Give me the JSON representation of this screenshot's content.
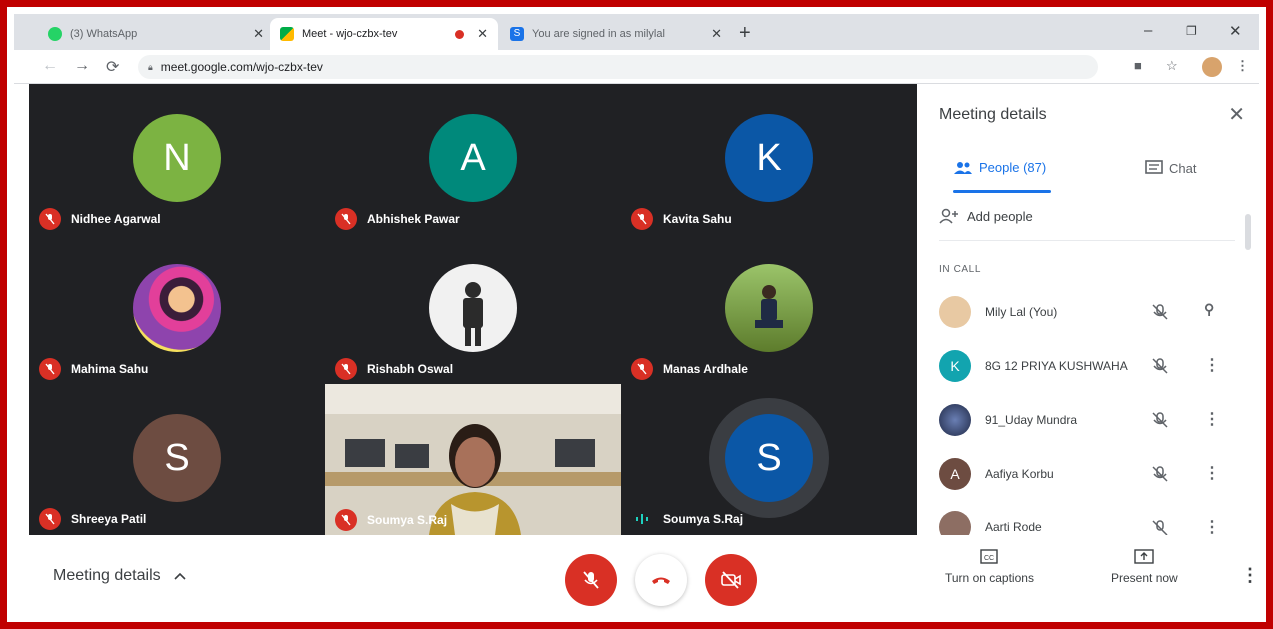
{
  "browser": {
    "tabs": [
      {
        "title": "(3) WhatsApp",
        "active": false
      },
      {
        "title": "Meet - wjo-czbx-tev",
        "active": true
      },
      {
        "title": "You are signed in as milylal",
        "active": false
      }
    ],
    "url": "meet.google.com/wjo-czbx-tev"
  },
  "grid": {
    "tiles": [
      {
        "name": "Nidhee Agarwal",
        "initial": "N",
        "color": "#7cb342"
      },
      {
        "name": "Abhishek Pawar",
        "initial": "A",
        "color": "#00897b"
      },
      {
        "name": "Kavita Sahu",
        "initial": "K",
        "color": "#0b57a6"
      },
      {
        "name": "Mahima Sahu",
        "initial": "",
        "color": "#8e44ad"
      },
      {
        "name": "Rishabh Oswal",
        "initial": "",
        "color": "#f1f1f1"
      },
      {
        "name": "Manas Ardhale",
        "initial": "",
        "color": "#6b8e23"
      },
      {
        "name": "Shreeya Patil",
        "initial": "S",
        "color": "#6d4c41"
      },
      {
        "name": "Soumya S.Raj",
        "initial": "",
        "color": "#c9c3b5"
      },
      {
        "name": "Soumya S.Raj",
        "initial": "S",
        "color": "#0b57a6"
      }
    ]
  },
  "panel": {
    "title": "Meeting details",
    "people_tab": "People (87)",
    "chat_tab": "Chat",
    "add_people": "Add people",
    "in_call_label": "IN CALL",
    "participants": [
      {
        "name": "Mily Lal (You)",
        "initial": "",
        "color": "#e8c9a3"
      },
      {
        "name": "8G 12 PRIYA KUSHWAHA",
        "initial": "K",
        "color": "#12a4af"
      },
      {
        "name": "91_Uday Mundra",
        "initial": "",
        "color": "#2d3a5a"
      },
      {
        "name": "Aafiya Korbu",
        "initial": "A",
        "color": "#6d4c41"
      },
      {
        "name": "Aarti Rode",
        "initial": "",
        "color": "#8d6e63"
      }
    ]
  },
  "bottombar": {
    "meeting_details": "Meeting details",
    "captions": "Turn on captions",
    "present": "Present now"
  },
  "colors": {
    "accent": "#1a73e8",
    "danger": "#d93025",
    "meet_bg": "#202124"
  }
}
